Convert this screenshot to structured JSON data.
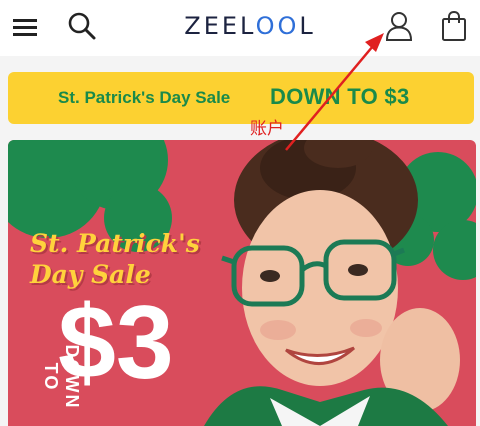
{
  "header": {
    "logo": "ZEELOOL",
    "icons": {
      "menu": "menu-icon",
      "search": "search-icon",
      "account": "account-icon",
      "bag": "shopping-bag-icon"
    }
  },
  "promo": {
    "left_text": "St. Patrick's Day Sale",
    "right_text": "DOWN TO $3"
  },
  "hero": {
    "title_line1": "St. Patrick's",
    "title_line2": "Day Sale",
    "down_to": "DOWN TO",
    "price": "$3"
  },
  "annotation": {
    "label": "账户"
  },
  "colors": {
    "brand_text": "#1c2340",
    "brand_accent": "#2f6fd8",
    "promo_bg": "#fcd131",
    "promo_text": "#1a8a4a",
    "hero_bg": "#d94c5c",
    "hero_title": "#ffd23c",
    "annotation": "#e02020"
  }
}
